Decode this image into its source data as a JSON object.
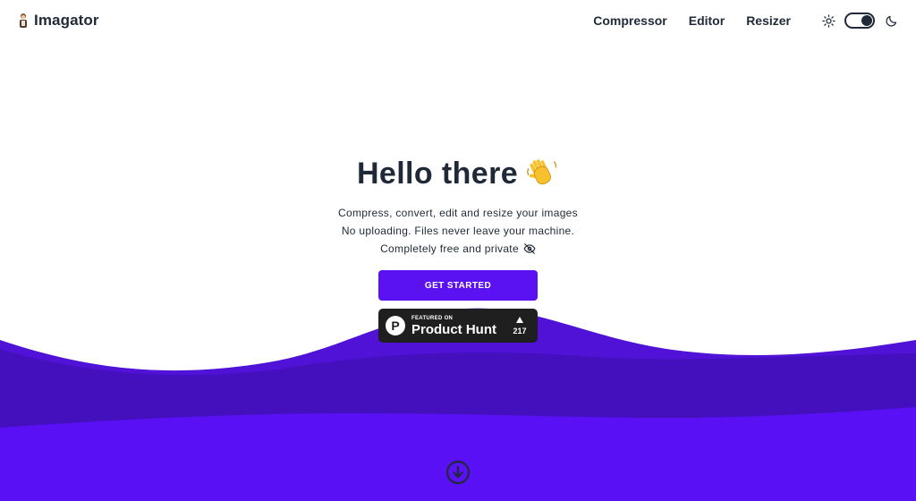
{
  "header": {
    "brand_name": "Imagator",
    "brand_icon": "imagator-logo",
    "nav": [
      {
        "label": "Compressor"
      },
      {
        "label": "Editor"
      },
      {
        "label": "Resizer"
      }
    ],
    "theme": {
      "light_icon": "sun-icon",
      "dark_icon": "moon-icon",
      "toggle_state": "dark"
    }
  },
  "hero": {
    "title": "Hello there",
    "title_icon": "waving-hand-emoji",
    "lines": [
      "Compress, convert, edit and resize your images",
      "No uploading. Files never leave your machine.",
      "Completely free and private"
    ],
    "privacy_icon": "eye-off-icon",
    "cta_label": "GET STARTED"
  },
  "product_hunt": {
    "featured_label": "FEATURED ON",
    "name": "Product Hunt",
    "logo_letter": "P",
    "votes": "217"
  },
  "scroll_icon": "arrow-down-circle-icon",
  "colors": {
    "accent": "#5b12f2",
    "wave_back": "#4f12d6",
    "wave_mid": "#4410bd",
    "wave_front": "#5a10f5",
    "text_dark": "#1f2937"
  }
}
